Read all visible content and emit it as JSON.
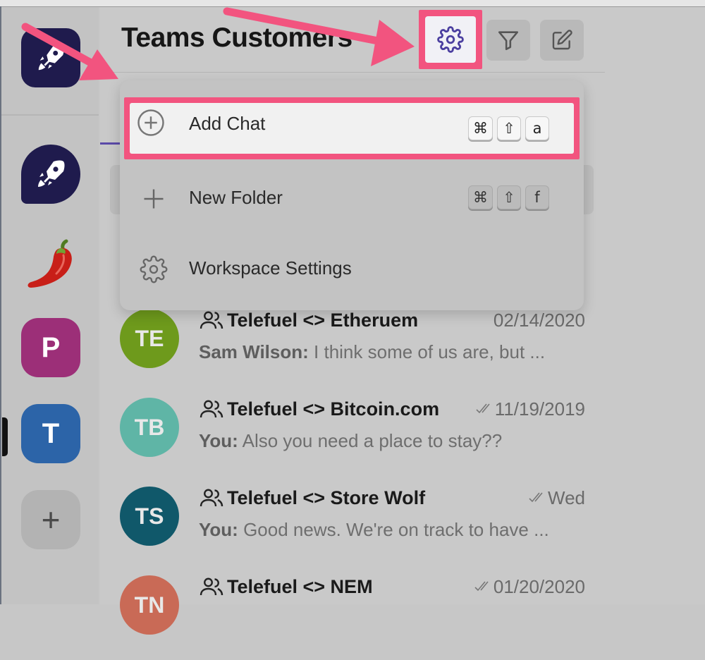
{
  "header": {
    "title": "Teams Customers",
    "settings_icon": "gear-icon",
    "filter_icon": "filter-icon",
    "compose_icon": "compose-icon"
  },
  "workspaces": [
    {
      "type": "logo",
      "icon": "rocket-icon"
    },
    {
      "type": "chat-bubble",
      "icon": "rocket-icon"
    },
    {
      "type": "emoji",
      "icon": "chili-pepper-icon"
    },
    {
      "type": "letter",
      "label": "P",
      "color": "#9c2f78"
    },
    {
      "type": "letter",
      "label": "T",
      "color": "#2c64a8"
    },
    {
      "type": "add",
      "label": "+"
    }
  ],
  "menu": {
    "items": [
      {
        "label": "Add Chat",
        "icon": "plus-circle-icon",
        "keys": [
          "⌘",
          "⇧",
          "a"
        ]
      },
      {
        "label": "New Folder",
        "icon": "plus-icon",
        "keys": [
          "⌘",
          "⇧",
          "f"
        ]
      },
      {
        "label": "Workspace Settings",
        "icon": "gear-icon",
        "keys": []
      }
    ]
  },
  "chats": [
    {
      "initials": "TE",
      "color": "#6e9a1c",
      "name": "Telefuel <> Etheruem",
      "date": "02/14/2020",
      "read": false,
      "sender": "Sam Wilson:",
      "preview": " I think some of us are, but ..."
    },
    {
      "initials": "TB",
      "color": "#5fb5a6",
      "name": "Telefuel <> Bitcoin.com",
      "date": "11/19/2019",
      "read": true,
      "sender": "You:",
      "preview": " Also you need a place to stay??"
    },
    {
      "initials": "TS",
      "color": "#10586a",
      "name": "Telefuel <> Store Wolf",
      "date": "Wed",
      "read": true,
      "sender": "You:",
      "preview": " Good news. We're on track to have ..."
    },
    {
      "initials": "TN",
      "color": "#c96a56",
      "name": "Telefuel <> NEM",
      "date": "01/20/2020",
      "read": true,
      "sender": "",
      "preview": ""
    }
  ],
  "colors": {
    "highlight": "#f2547f",
    "accent": "#5b4aa8",
    "brand": "#1f1b4d"
  }
}
